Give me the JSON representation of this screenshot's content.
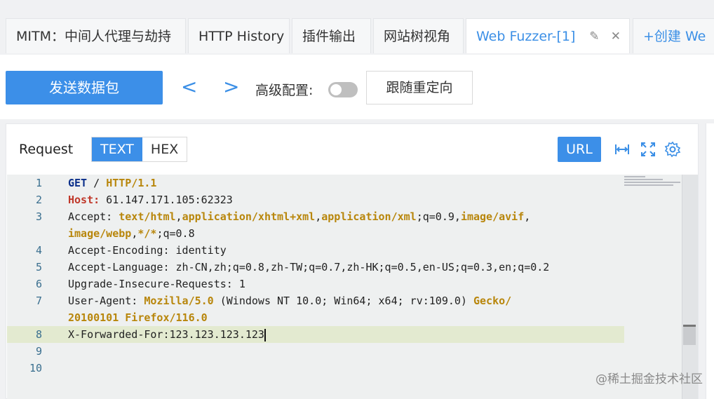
{
  "tabs": [
    {
      "label": "MITM：中间人代理与劫持"
    },
    {
      "label": "HTTP History"
    },
    {
      "label": "插件输出"
    },
    {
      "label": "网站树视角"
    },
    {
      "label": "Web Fuzzer-[1]",
      "active": true
    },
    {
      "label": "+创建 We"
    }
  ],
  "toolbar": {
    "send_label": "发送数据包",
    "prev_arrow": "<",
    "next_arrow": ">",
    "advanced_label": "高级配置:",
    "advanced_enabled": false,
    "redirect_label": "跟随重定向"
  },
  "request_panel": {
    "title": "Request",
    "mode_text": "TEXT",
    "mode_hex": "HEX",
    "url_button": "URL",
    "icons": [
      "fit-width-icon",
      "fullscreen-icon",
      "settings-icon"
    ]
  },
  "editor": {
    "lines": [
      {
        "n": "1",
        "text": "GET / HTTP/1.1"
      },
      {
        "n": "2",
        "text": "Host: 61.147.171.105:62323"
      },
      {
        "n": "3",
        "text": "Accept: text/html,application/xhtml+xml,application/xml;q=0.9,image/avif,"
      },
      {
        "n": "",
        "text": "image/webp,*/*;q=0.8"
      },
      {
        "n": "4",
        "text": "Accept-Encoding: identity"
      },
      {
        "n": "5",
        "text": "Accept-Language: zh-CN,zh;q=0.8,zh-TW;q=0.7,zh-HK;q=0.5,en-US;q=0.3,en;q=0.2"
      },
      {
        "n": "6",
        "text": "Upgrade-Insecure-Requests: 1"
      },
      {
        "n": "7",
        "text": "User-Agent: Mozilla/5.0 (Windows NT 10.0; Win64; x64; rv:109.0) Gecko/"
      },
      {
        "n": "",
        "text": "20100101 Firefox/116.0"
      },
      {
        "n": "8",
        "text": "X-Forwarded-For:123.123.123.123"
      },
      {
        "n": "9",
        "text": ""
      },
      {
        "n": "10",
        "text": ""
      }
    ]
  },
  "watermark": "@稀土掘金技术社区"
}
